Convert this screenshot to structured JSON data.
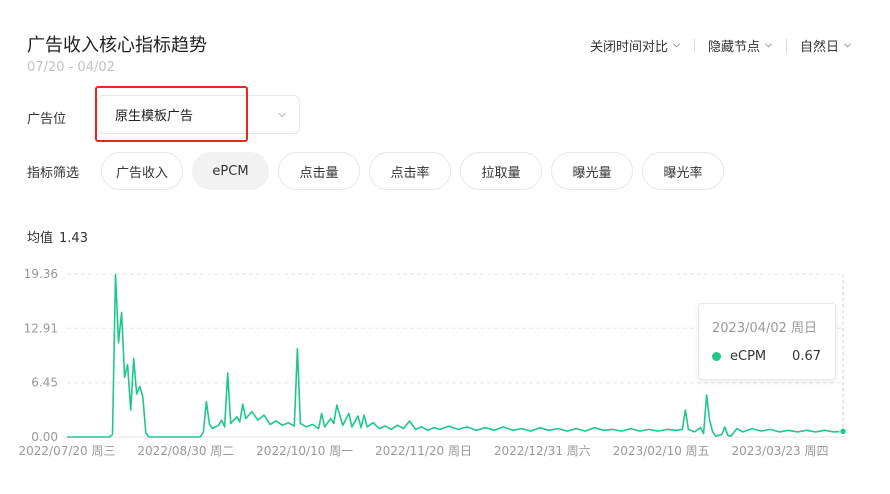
{
  "header": {
    "title": "广告收入核心指标趋势",
    "date_range": "07/20 - 04/02",
    "controls": [
      "关闭时间对比",
      "隐藏节点",
      "自然日"
    ]
  },
  "ad_position": {
    "label": "广告位",
    "selected": "原生模板广告"
  },
  "metric_filter": {
    "label": "指标筛选",
    "options": [
      "广告收入",
      "ePCM",
      "点击量",
      "点击率",
      "拉取量",
      "曝光量",
      "曝光率"
    ],
    "active": "ePCM"
  },
  "average": {
    "label": "均值",
    "value": "1.43"
  },
  "tooltip": {
    "date": "2023/04/02 周日",
    "series": "eCPM",
    "value": "0.67"
  },
  "colors": {
    "series": "#1ec88a",
    "highlight": "#e8281e",
    "grid": "#e6e6e6"
  },
  "chart_data": {
    "type": "line",
    "series": [
      {
        "name": "eCPM"
      }
    ],
    "ylim": [
      0,
      19.36
    ],
    "y_ticks": [
      "0.00",
      "6.45",
      "12.91",
      "19.36"
    ],
    "x_ticks": [
      "2022/07/20 周三",
      "2022/08/30 周二",
      "2022/10/10 周一",
      "2022/11/20 周日",
      "2022/12/31 周六",
      "2023/02/10 周五",
      "2023/03/23 周四"
    ],
    "x_start": "2022-07-20",
    "points": [
      [
        "2022-07-20",
        0
      ],
      [
        "2022-08-03",
        0
      ],
      [
        "2022-08-04",
        0.3
      ],
      [
        "2022-08-05",
        19.3
      ],
      [
        "2022-08-06",
        11.2
      ],
      [
        "2022-08-07",
        14.8
      ],
      [
        "2022-08-08",
        7.1
      ],
      [
        "2022-08-09",
        8.6
      ],
      [
        "2022-08-10",
        3.2
      ],
      [
        "2022-08-11",
        9.3
      ],
      [
        "2022-08-12",
        5.1
      ],
      [
        "2022-08-13",
        6.0
      ],
      [
        "2022-08-14",
        4.8
      ],
      [
        "2022-08-15",
        0.5
      ],
      [
        "2022-08-16",
        0
      ],
      [
        "2022-09-02",
        0
      ],
      [
        "2022-09-03",
        0.6
      ],
      [
        "2022-09-04",
        4.2
      ],
      [
        "2022-09-05",
        1.5
      ],
      [
        "2022-09-06",
        1.0
      ],
      [
        "2022-09-08",
        1.4
      ],
      [
        "2022-09-09",
        2.0
      ],
      [
        "2022-09-10",
        1.2
      ],
      [
        "2022-09-11",
        7.6
      ],
      [
        "2022-09-12",
        1.6
      ],
      [
        "2022-09-14",
        2.4
      ],
      [
        "2022-09-15",
        1.8
      ],
      [
        "2022-09-16",
        3.9
      ],
      [
        "2022-09-17",
        2.2
      ],
      [
        "2022-09-19",
        3.0
      ],
      [
        "2022-09-21",
        2.0
      ],
      [
        "2022-09-23",
        2.6
      ],
      [
        "2022-09-25",
        1.5
      ],
      [
        "2022-09-27",
        1.9
      ],
      [
        "2022-09-29",
        1.4
      ],
      [
        "2022-10-01",
        1.7
      ],
      [
        "2022-10-03",
        1.3
      ],
      [
        "2022-10-04",
        10.5
      ],
      [
        "2022-10-05",
        1.6
      ],
      [
        "2022-10-07",
        1.2
      ],
      [
        "2022-10-09",
        1.5
      ],
      [
        "2022-10-11",
        1.0
      ],
      [
        "2022-10-12",
        2.8
      ],
      [
        "2022-10-13",
        1.2
      ],
      [
        "2022-10-15",
        2.2
      ],
      [
        "2022-10-16",
        1.6
      ],
      [
        "2022-10-17",
        3.8
      ],
      [
        "2022-10-18",
        2.6
      ],
      [
        "2022-10-19",
        1.4
      ],
      [
        "2022-10-21",
        2.8
      ],
      [
        "2022-10-22",
        1.2
      ],
      [
        "2022-10-24",
        2.5
      ],
      [
        "2022-10-25",
        1.1
      ],
      [
        "2022-10-26",
        2.6
      ],
      [
        "2022-10-27",
        1.2
      ],
      [
        "2022-10-29",
        1.7
      ],
      [
        "2022-10-31",
        1.0
      ],
      [
        "2022-11-02",
        1.3
      ],
      [
        "2022-11-04",
        0.9
      ],
      [
        "2022-11-06",
        1.4
      ],
      [
        "2022-11-08",
        1.0
      ],
      [
        "2022-11-10",
        1.9
      ],
      [
        "2022-11-12",
        0.9
      ],
      [
        "2022-11-14",
        1.2
      ],
      [
        "2022-11-16",
        0.8
      ],
      [
        "2022-11-18",
        1.1
      ],
      [
        "2022-11-20",
        0.9
      ],
      [
        "2022-11-23",
        1.3
      ],
      [
        "2022-11-26",
        0.9
      ],
      [
        "2022-11-29",
        1.2
      ],
      [
        "2022-12-02",
        0.8
      ],
      [
        "2022-12-05",
        1.1
      ],
      [
        "2022-12-08",
        0.8
      ],
      [
        "2022-12-11",
        1.2
      ],
      [
        "2022-12-14",
        0.8
      ],
      [
        "2022-12-17",
        1.0
      ],
      [
        "2022-12-20",
        0.7
      ],
      [
        "2022-12-23",
        1.1
      ],
      [
        "2022-12-26",
        0.8
      ],
      [
        "2022-12-29",
        1.0
      ],
      [
        "2023-01-01",
        0.7
      ],
      [
        "2023-01-04",
        1.0
      ],
      [
        "2023-01-07",
        0.7
      ],
      [
        "2023-01-10",
        1.1
      ],
      [
        "2023-01-13",
        0.8
      ],
      [
        "2023-01-16",
        0.9
      ],
      [
        "2023-01-19",
        0.7
      ],
      [
        "2023-01-22",
        1.0
      ],
      [
        "2023-01-25",
        0.7
      ],
      [
        "2023-01-28",
        0.9
      ],
      [
        "2023-01-31",
        0.7
      ],
      [
        "2023-02-03",
        0.9
      ],
      [
        "2023-02-06",
        0.8
      ],
      [
        "2023-02-08",
        0.9
      ],
      [
        "2023-02-09",
        3.2
      ],
      [
        "2023-02-10",
        0.9
      ],
      [
        "2023-02-12",
        0.6
      ],
      [
        "2023-02-14",
        1.1
      ],
      [
        "2023-02-15",
        0.4
      ],
      [
        "2023-02-16",
        5.0
      ],
      [
        "2023-02-17",
        2.0
      ],
      [
        "2023-02-18",
        0.6
      ],
      [
        "2023-02-19",
        0.1
      ],
      [
        "2023-02-21",
        0.3
      ],
      [
        "2023-02-22",
        1.2
      ],
      [
        "2023-02-23",
        0.2
      ],
      [
        "2023-02-24",
        0.1
      ],
      [
        "2023-02-26",
        1.0
      ],
      [
        "2023-02-28",
        0.6
      ],
      [
        "2023-03-03",
        1.0
      ],
      [
        "2023-03-06",
        0.7
      ],
      [
        "2023-03-09",
        0.9
      ],
      [
        "2023-03-12",
        0.6
      ],
      [
        "2023-03-15",
        0.8
      ],
      [
        "2023-03-18",
        0.6
      ],
      [
        "2023-03-21",
        0.8
      ],
      [
        "2023-03-24",
        0.6
      ],
      [
        "2023-03-27",
        0.8
      ],
      [
        "2023-03-30",
        0.6
      ],
      [
        "2023-04-02",
        0.67
      ]
    ],
    "highlight": {
      "x": "2023-04-02",
      "y": 0.67
    }
  }
}
